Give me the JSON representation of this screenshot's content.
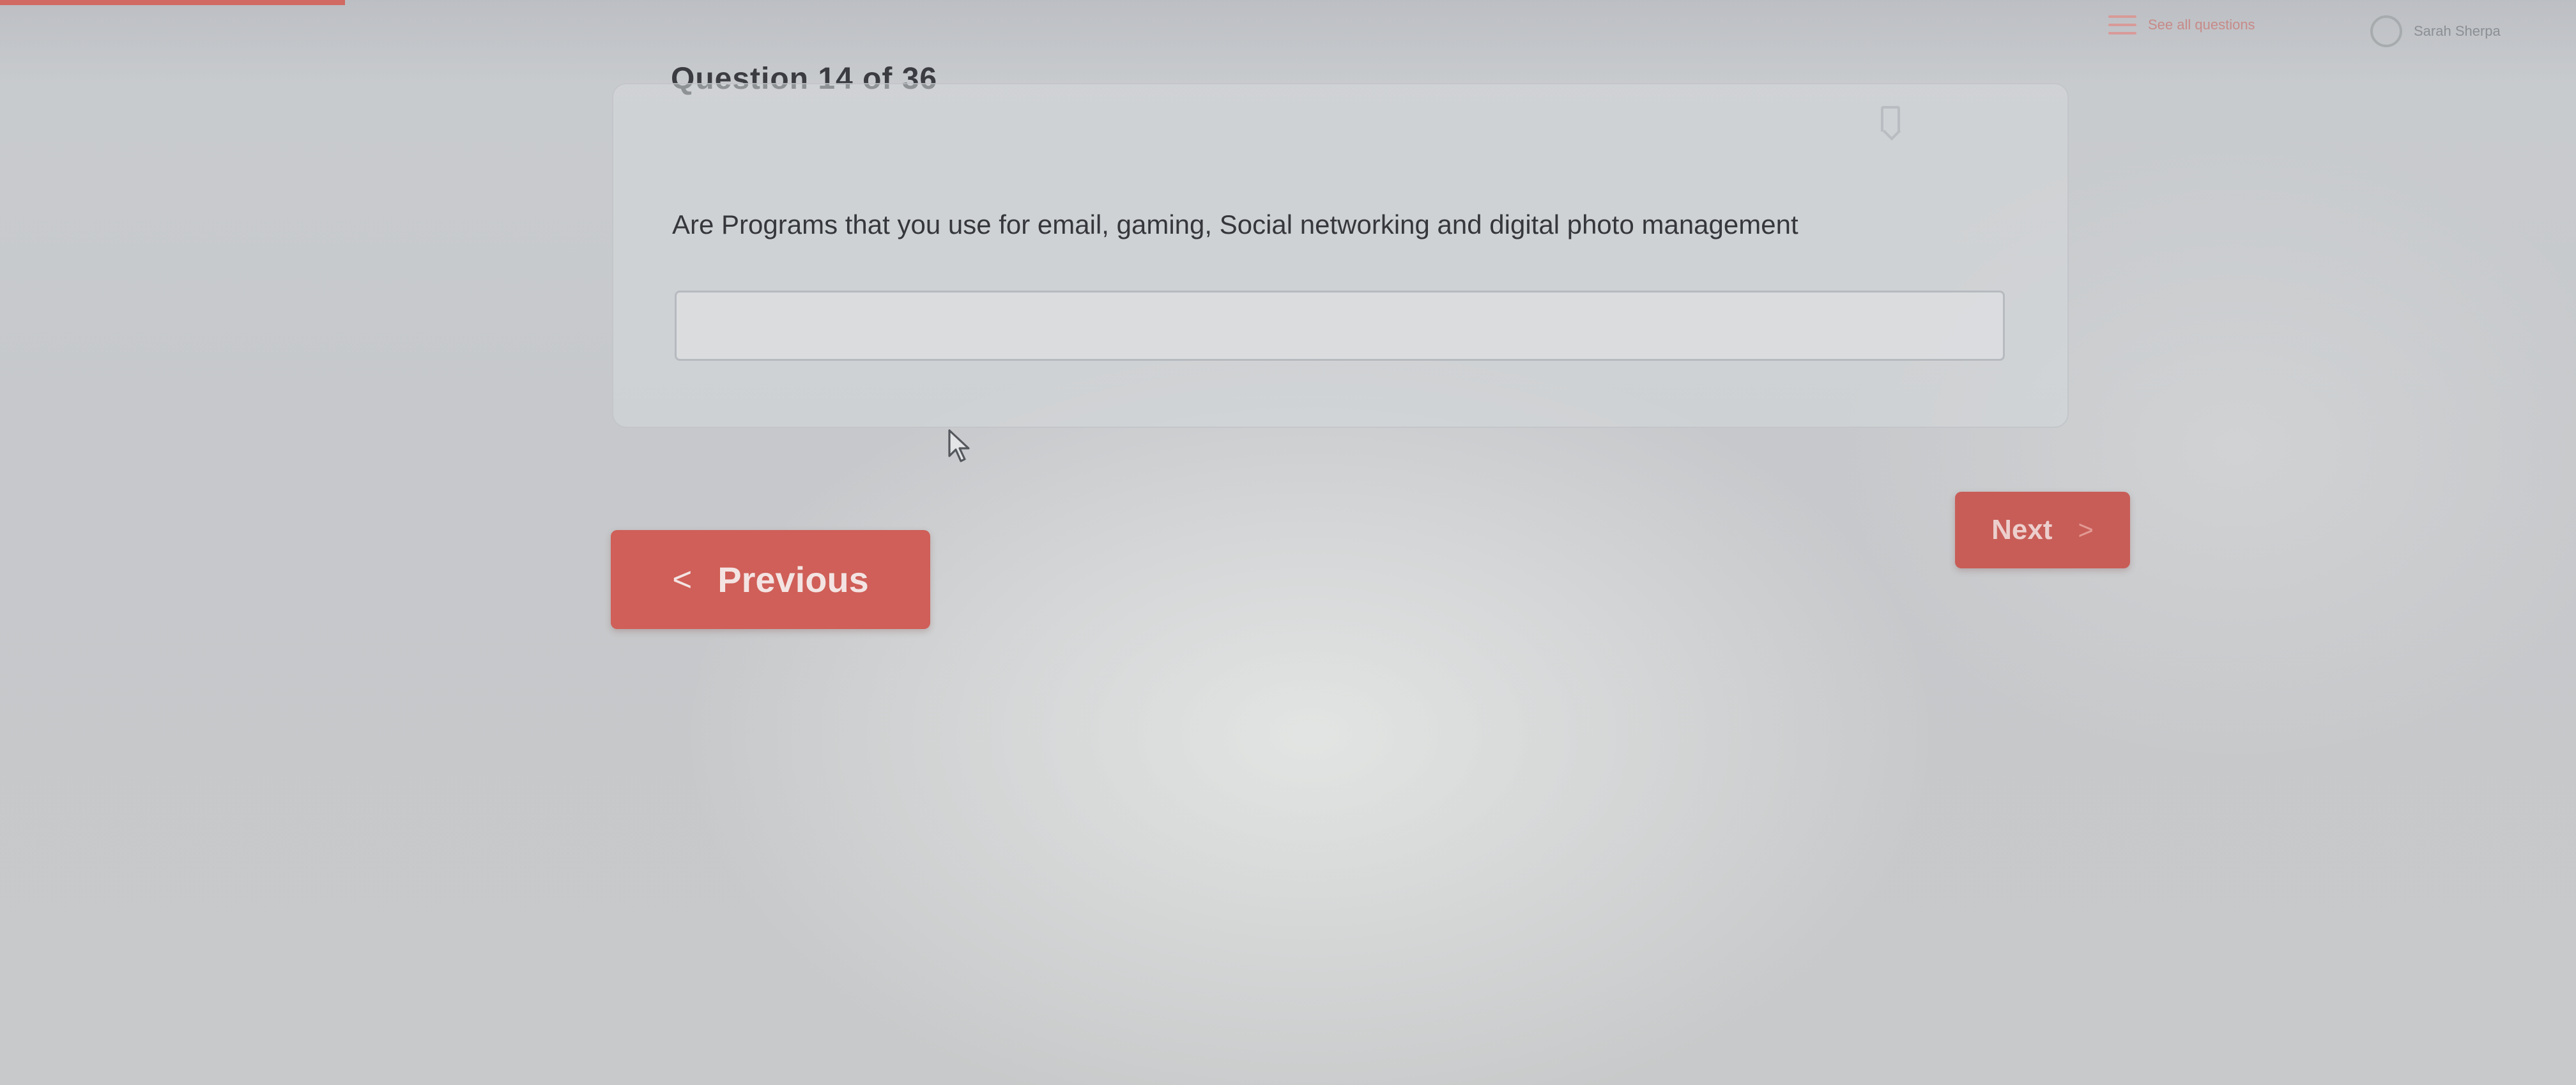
{
  "header": {
    "question_counter": "Question 14 of 36",
    "see_all_questions_label": "See all questions",
    "account_label": "Sarah Sherpa"
  },
  "question": {
    "prompt": "Are Programs that you use for email, gaming, Social networking and digital photo management",
    "answer_value": "",
    "answer_placeholder": ""
  },
  "navigation": {
    "previous_label": "Previous",
    "next_label": "Next",
    "previous_chevron": "<",
    "next_chevron": ">"
  },
  "icons": {
    "question_list": "list-icon",
    "account": "user-circle-icon",
    "bookmark": "bookmark-icon",
    "cursor": "mouse-pointer-icon"
  },
  "colors": {
    "accent": "#cf5f58",
    "background": "#c9cccf",
    "text": "#35373c"
  }
}
